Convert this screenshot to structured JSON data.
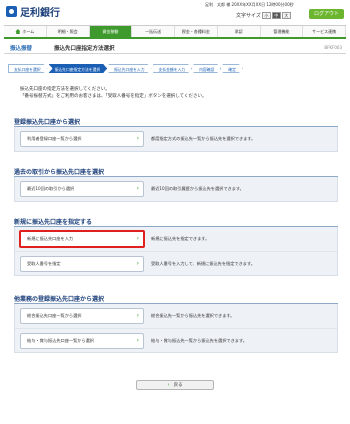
{
  "header": {
    "bank_name": "足利銀行",
    "user_info": "足利　太郎 様 20XX年XX月XX日 12時00分00秒",
    "font_size_label": "文字サイズ",
    "font_sizes": [
      "小",
      "中",
      "大"
    ],
    "logout_label": "ログアウト"
  },
  "nav": {
    "items": [
      "ホーム",
      "明細・照会",
      "資金移動",
      "一括伝送",
      "税金・各種料金",
      "承認",
      "管理機能",
      "サービス連携"
    ]
  },
  "title": {
    "category": "振込振替",
    "main": "振込先口座指定方法選択",
    "screen_id": "BFKF003"
  },
  "steps": [
    "支払口座を選択",
    "振込先口座指定方法を選択",
    "振込先口座を入力",
    "支払金額を入力",
    "内容確認",
    "確定"
  ],
  "intro": {
    "line1": "振込先口座の指定方法を選択してください。",
    "line2": "「番号振替方式」をご利用のお客さまは、「受取人番号を指定」ボタンを選択してください。"
  },
  "sections": [
    {
      "title": "登録振込先口座から選択",
      "rows": [
        {
          "button": "利用者登録口座一覧から選択",
          "desc": "都度指定方式の振込先一覧から振込先を選択できます。"
        }
      ]
    },
    {
      "title": "過去の取引から振込先口座を選択",
      "rows": [
        {
          "button": "最近10回の取引から選択",
          "desc": "最近10回の取引履歴から振込先を選択できます。"
        }
      ]
    },
    {
      "title": "新規に振込先口座を指定する",
      "rows": [
        {
          "button": "新規に振込先口座を入力",
          "desc": "新規に振込先を指定できます。"
        },
        {
          "button": "受取人番号を指定",
          "desc": "受取人番号を入力して、新規に振込先を指定できます。"
        }
      ]
    },
    {
      "title": "他業務の登録振込先口座から選択",
      "rows": [
        {
          "button": "総合振込先口座一覧から選択",
          "desc": "総合振込先一覧から振込先を選択できます。"
        },
        {
          "button": "給与・賞与振込先口座一覧から選択",
          "desc": "給与・賞与振込先一覧から振込先を選択できます。"
        }
      ]
    }
  ],
  "back_label": "戻る"
}
